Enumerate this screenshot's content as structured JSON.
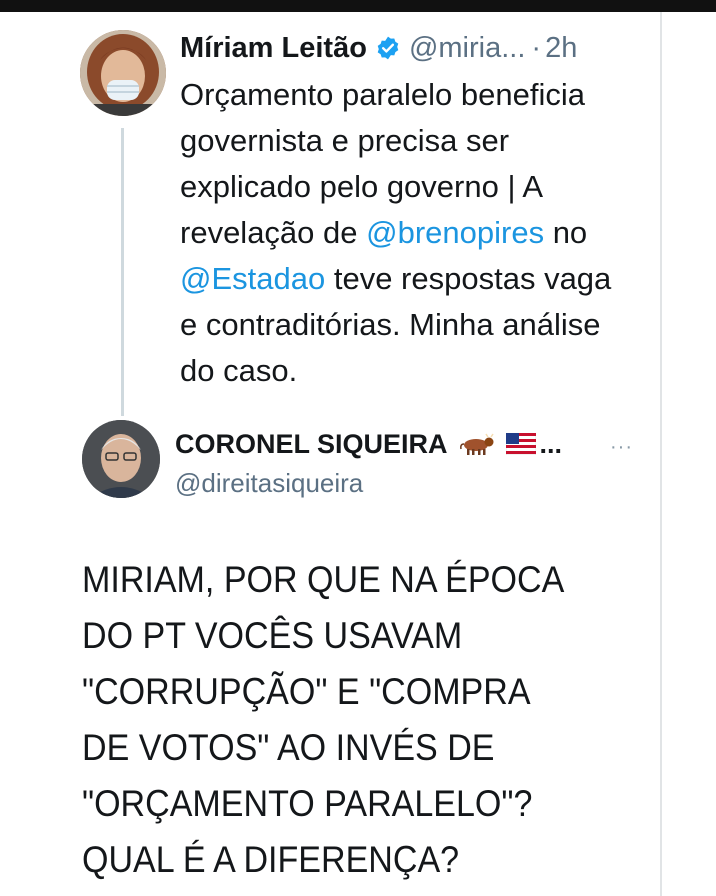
{
  "tweet1": {
    "author_name": "Míriam Leitão",
    "handle": "@miria...",
    "separator": "·",
    "time": "2h",
    "text_segments": [
      {
        "text": "Orçamento paralelo beneficia"
      },
      {
        "text": "governista e precisa ser"
      },
      {
        "text": "explicado pelo governo | A"
      },
      {
        "text": "revelação de ",
        "mention": "@brenopires",
        "tail": " no"
      },
      {
        "mention": "@Estadao",
        "tail": " teve respostas vaga"
      },
      {
        "text": "e contraditórias. Minha análise"
      },
      {
        "text": "do caso."
      }
    ]
  },
  "tweet2": {
    "author_name": "CORONEL SIQUEIRA",
    "ellipsis": "...",
    "handle": "@direitasiqueira",
    "more": "···",
    "text_lines": [
      "MIRIAM, POR QUE NA ÉPOCA",
      "DO PT VOCÊS USAVAM",
      "\"CORRUPÇÃO\" E \"COMPRA",
      "DE VOTOS\" AO INVÉS DE",
      "\"ORÇAMENTO PARALELO\"?",
      "QUAL É A DIFERENÇA?"
    ]
  },
  "colors": {
    "link": "#1b95e0",
    "verified": "#1da1f2",
    "muted": "#5b7083",
    "thread_line": "#cfd9de"
  },
  "icons": [
    "verified-badge-icon",
    "bull-emoji-icon",
    "flag-emoji-icon",
    "more-options-icon"
  ]
}
